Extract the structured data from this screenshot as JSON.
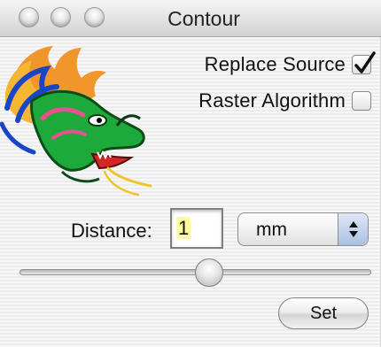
{
  "window": {
    "title": "Contour"
  },
  "options": {
    "replace_source_label": "Replace Source",
    "replace_source_checked": true,
    "raster_algorithm_label": "Raster Algorithm",
    "raster_algorithm_checked": false
  },
  "distance": {
    "label": "Distance:",
    "value": "1",
    "unit": "mm"
  },
  "slider": {
    "level": 0.5
  },
  "actions": {
    "set_label": "Set"
  },
  "icons": {
    "logo": "dragon-logo",
    "close": "close-icon",
    "minimize": "minimize-icon",
    "zoom": "zoom-icon"
  }
}
